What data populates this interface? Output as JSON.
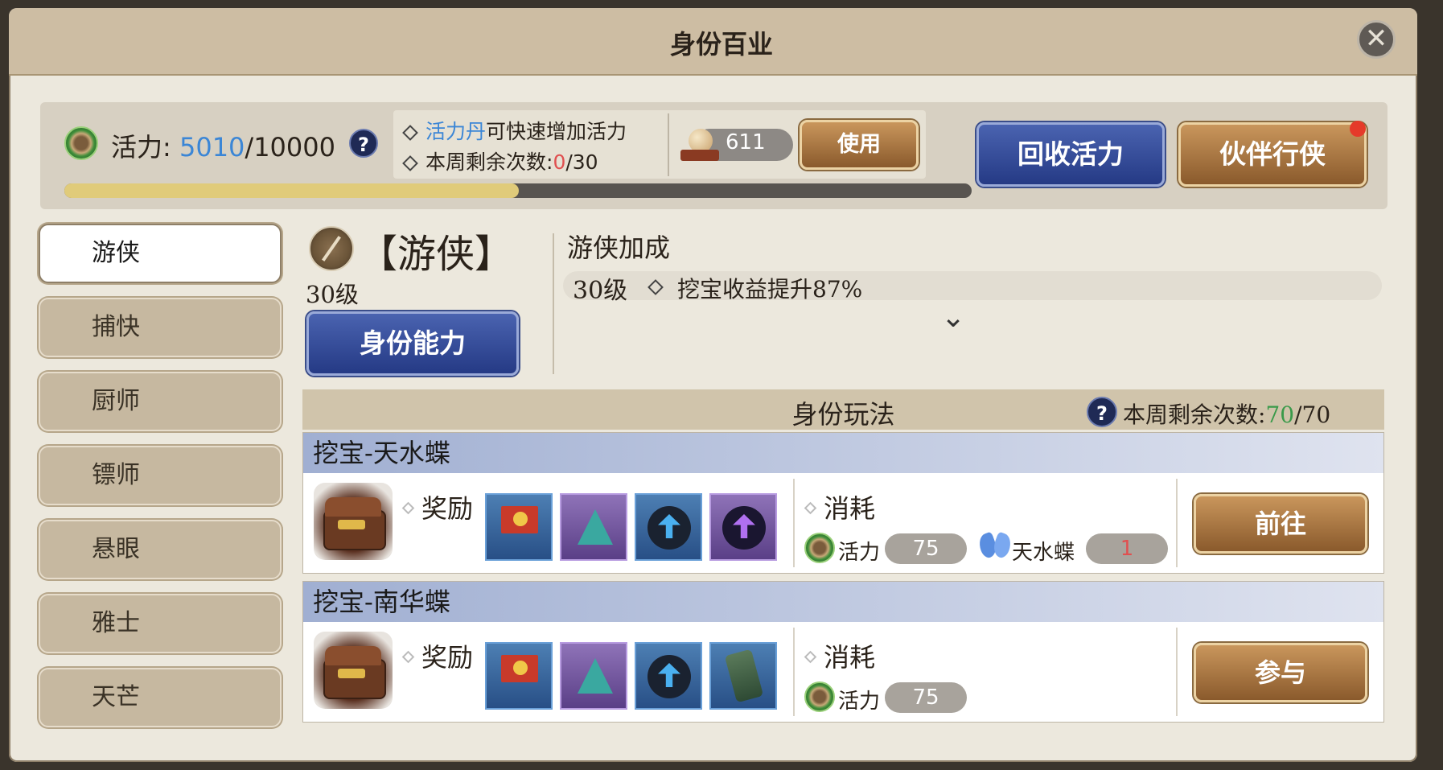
{
  "window": {
    "title": "身份百业",
    "close_symbol": "✕"
  },
  "vitality": {
    "label": "活力:",
    "current": "5010",
    "max": "/10000",
    "help": "?",
    "progress_fraction": 0.501,
    "tip_item_name": "活力丹",
    "tip_item_text": "可快速增加活力",
    "weekly_label": "本周剩余次数:",
    "weekly_used": "0",
    "weekly_total": "/30",
    "item_count": "611",
    "use_button": "使用",
    "recycle_button": "回收活力",
    "partner_button": "伙伴行侠"
  },
  "sidebar": {
    "items": [
      {
        "label": "游侠"
      },
      {
        "label": "捕快"
      },
      {
        "label": "厨师"
      },
      {
        "label": "镖师"
      },
      {
        "label": "悬眼"
      },
      {
        "label": "雅士"
      },
      {
        "label": "天芒"
      }
    ]
  },
  "identity": {
    "name": "【游侠】",
    "level": "30级",
    "ability_button": "身份能力",
    "bonus_title": "游侠加成",
    "bonus_level": "30级",
    "bonus_text": "挖宝收益提升87%",
    "expand_symbol": "⌄"
  },
  "gameplay": {
    "title": "身份玩法",
    "help": "?",
    "weekly_label": "本周剩余次数:",
    "weekly_remaining": "70",
    "weekly_total": "/70",
    "colors": {
      "remaining": "#3a9a4a",
      "accent_red": "#e05050",
      "blue_text": "#3b86d6"
    },
    "activities": [
      {
        "title": "挖宝-天水蝶",
        "reward_label": "奖励",
        "rewards": [
          "red-banner-icon",
          "purple-pennant-icon",
          "blue-boost-stone-icon",
          "purple-boost-stone-icon"
        ],
        "cost_label": "消耗",
        "cost_vitality_label": "活力",
        "cost_vitality": "75",
        "cost_item_label": "天水蝶",
        "cost_item_amount": "1",
        "action_button": "前往"
      },
      {
        "title": "挖宝-南华蝶",
        "reward_label": "奖励",
        "rewards": [
          "red-banner-icon",
          "purple-pennant-icon",
          "blue-boost-stone-icon",
          "jade-token-icon"
        ],
        "cost_label": "消耗",
        "cost_vitality_label": "活力",
        "cost_vitality": "75",
        "action_button": "参与"
      }
    ]
  }
}
